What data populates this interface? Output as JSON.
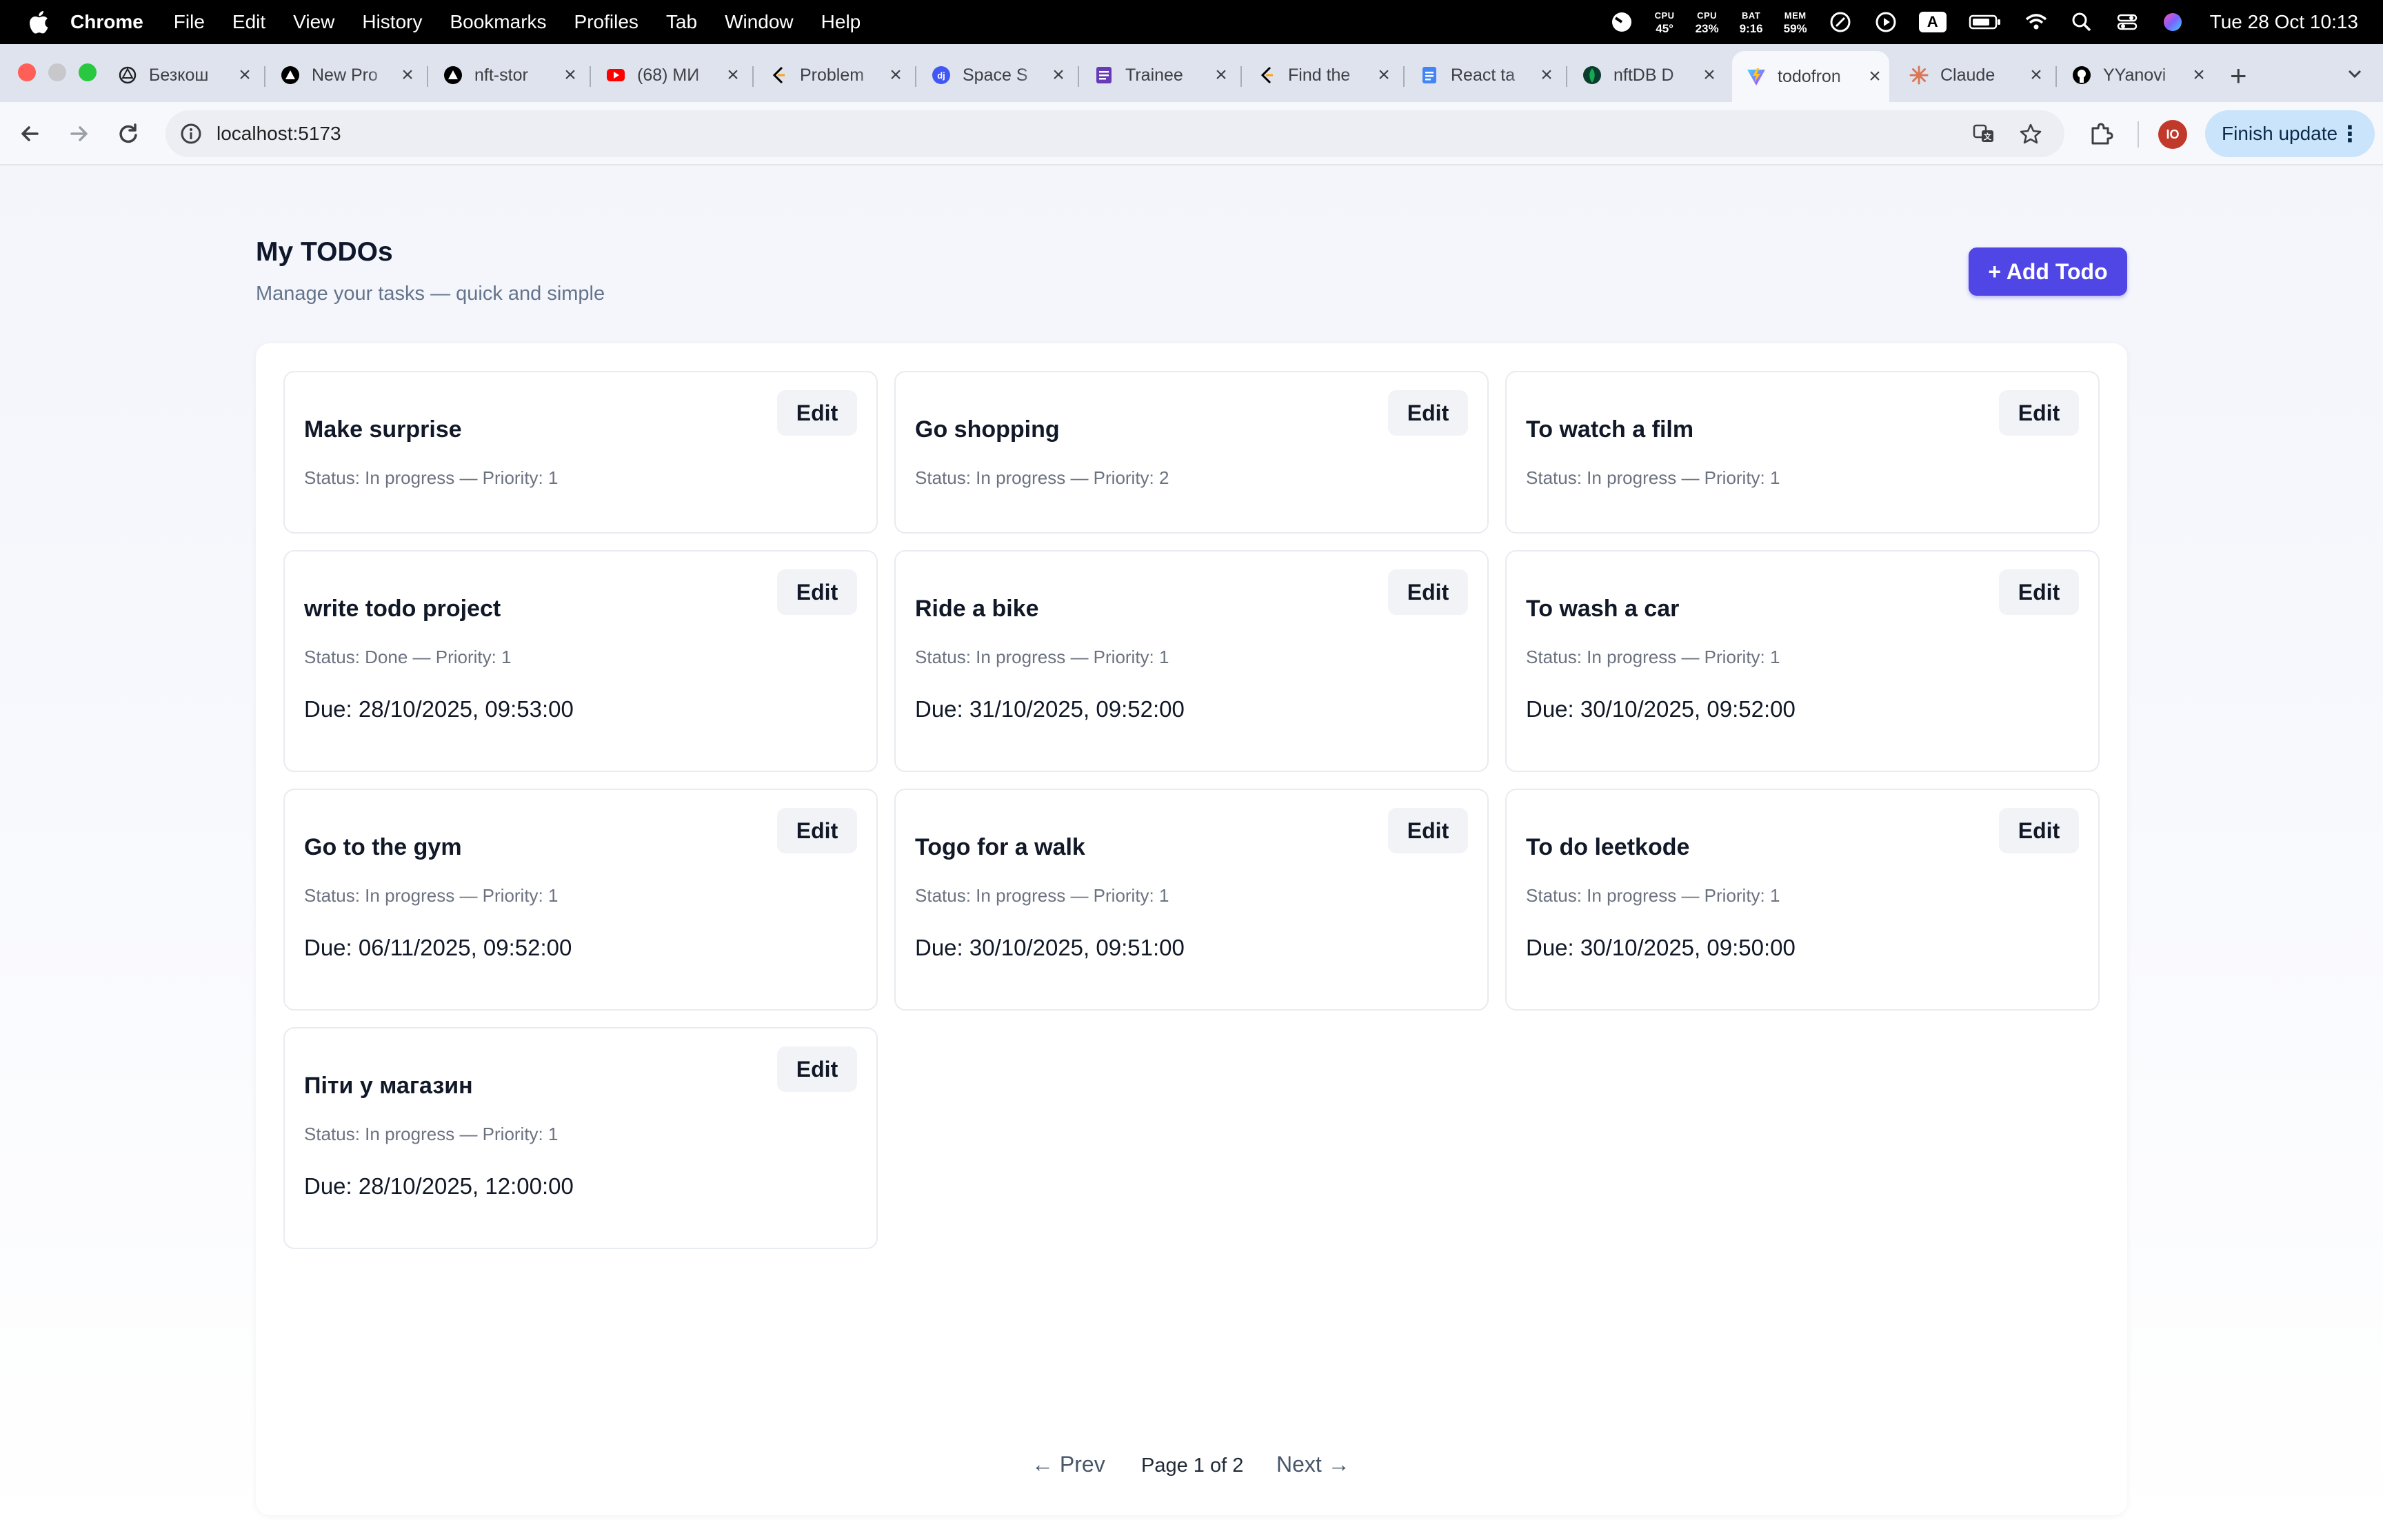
{
  "menubar": {
    "app_name": "Chrome",
    "items": [
      "File",
      "Edit",
      "View",
      "History",
      "Bookmarks",
      "Profiles",
      "Tab",
      "Window",
      "Help"
    ],
    "stats": [
      {
        "label": "CPU",
        "value": "45°"
      },
      {
        "label": "CPU",
        "value": "23%"
      },
      {
        "label": "BAT",
        "value": "9:16"
      },
      {
        "label": "MEM",
        "value": "59%"
      }
    ],
    "input_badge": "A",
    "clock": "Tue 28 Oct  10:13"
  },
  "tabs": [
    {
      "title": "Безкош",
      "icon": "openai-icon"
    },
    {
      "title": "New Pro",
      "icon": "vercel-icon"
    },
    {
      "title": "nft-stor",
      "icon": "vercel-icon"
    },
    {
      "title": "(68) МИ",
      "icon": "youtube-icon"
    },
    {
      "title": "Problem",
      "icon": "leetcode-icon"
    },
    {
      "title": "Space S",
      "icon": "djinni-icon"
    },
    {
      "title": "Trainee",
      "icon": "forms-icon"
    },
    {
      "title": "Find the",
      "icon": "leetcode-icon"
    },
    {
      "title": "React ta",
      "icon": "docs-icon"
    },
    {
      "title": "nftDB D",
      "icon": "mongodb-icon"
    },
    {
      "title": "todofron",
      "icon": "vite-icon",
      "active": true
    },
    {
      "title": "Claude",
      "icon": "claude-icon"
    },
    {
      "title": "YYanovi",
      "icon": "github-icon"
    }
  ],
  "toolbar": {
    "url": "localhost:5173",
    "profile_initials": "IO",
    "finish_update": "Finish update"
  },
  "page": {
    "title": "My TODOs",
    "subtitle": "Manage your tasks — quick and simple",
    "add_button": "+ Add Todo",
    "edit_label": "Edit"
  },
  "todos": [
    {
      "title": "Make surprise",
      "status": "Status: In progress — Priority: 1",
      "due": ""
    },
    {
      "title": "Go shopping",
      "status": "Status: In progress — Priority: 2",
      "due": ""
    },
    {
      "title": "To watch a film",
      "status": "Status: In progress — Priority: 1",
      "due": ""
    },
    {
      "title": "write todo project",
      "status": "Status: Done — Priority: 1",
      "due": "Due: 28/10/2025, 09:53:00"
    },
    {
      "title": "Ride a bike",
      "status": "Status: In progress — Priority: 1",
      "due": "Due: 31/10/2025, 09:52:00"
    },
    {
      "title": "To wash a car",
      "status": "Status: In progress — Priority: 1",
      "due": "Due: 30/10/2025, 09:52:00"
    },
    {
      "title": "Go to the gym",
      "status": "Status: In progress — Priority: 1",
      "due": "Due: 06/11/2025, 09:52:00"
    },
    {
      "title": "Togo for a walk",
      "status": "Status: In progress — Priority: 1",
      "due": "Due: 30/10/2025, 09:51:00"
    },
    {
      "title": "To do leetkode",
      "status": "Status: In progress — Priority: 1",
      "due": "Due: 30/10/2025, 09:50:00"
    },
    {
      "title": "Піти у магазин",
      "status": "Status: In progress — Priority: 1",
      "due": "Due: 28/10/2025, 12:00:00"
    }
  ],
  "pagination": {
    "prev": "← Prev",
    "info": "Page 1 of 2",
    "next": "Next →"
  },
  "colors": {
    "accent": "#4f46e5",
    "menubar_bg": "#000000",
    "tabstrip_bg": "#dfe3ee",
    "muted_text": "#6b7280"
  }
}
